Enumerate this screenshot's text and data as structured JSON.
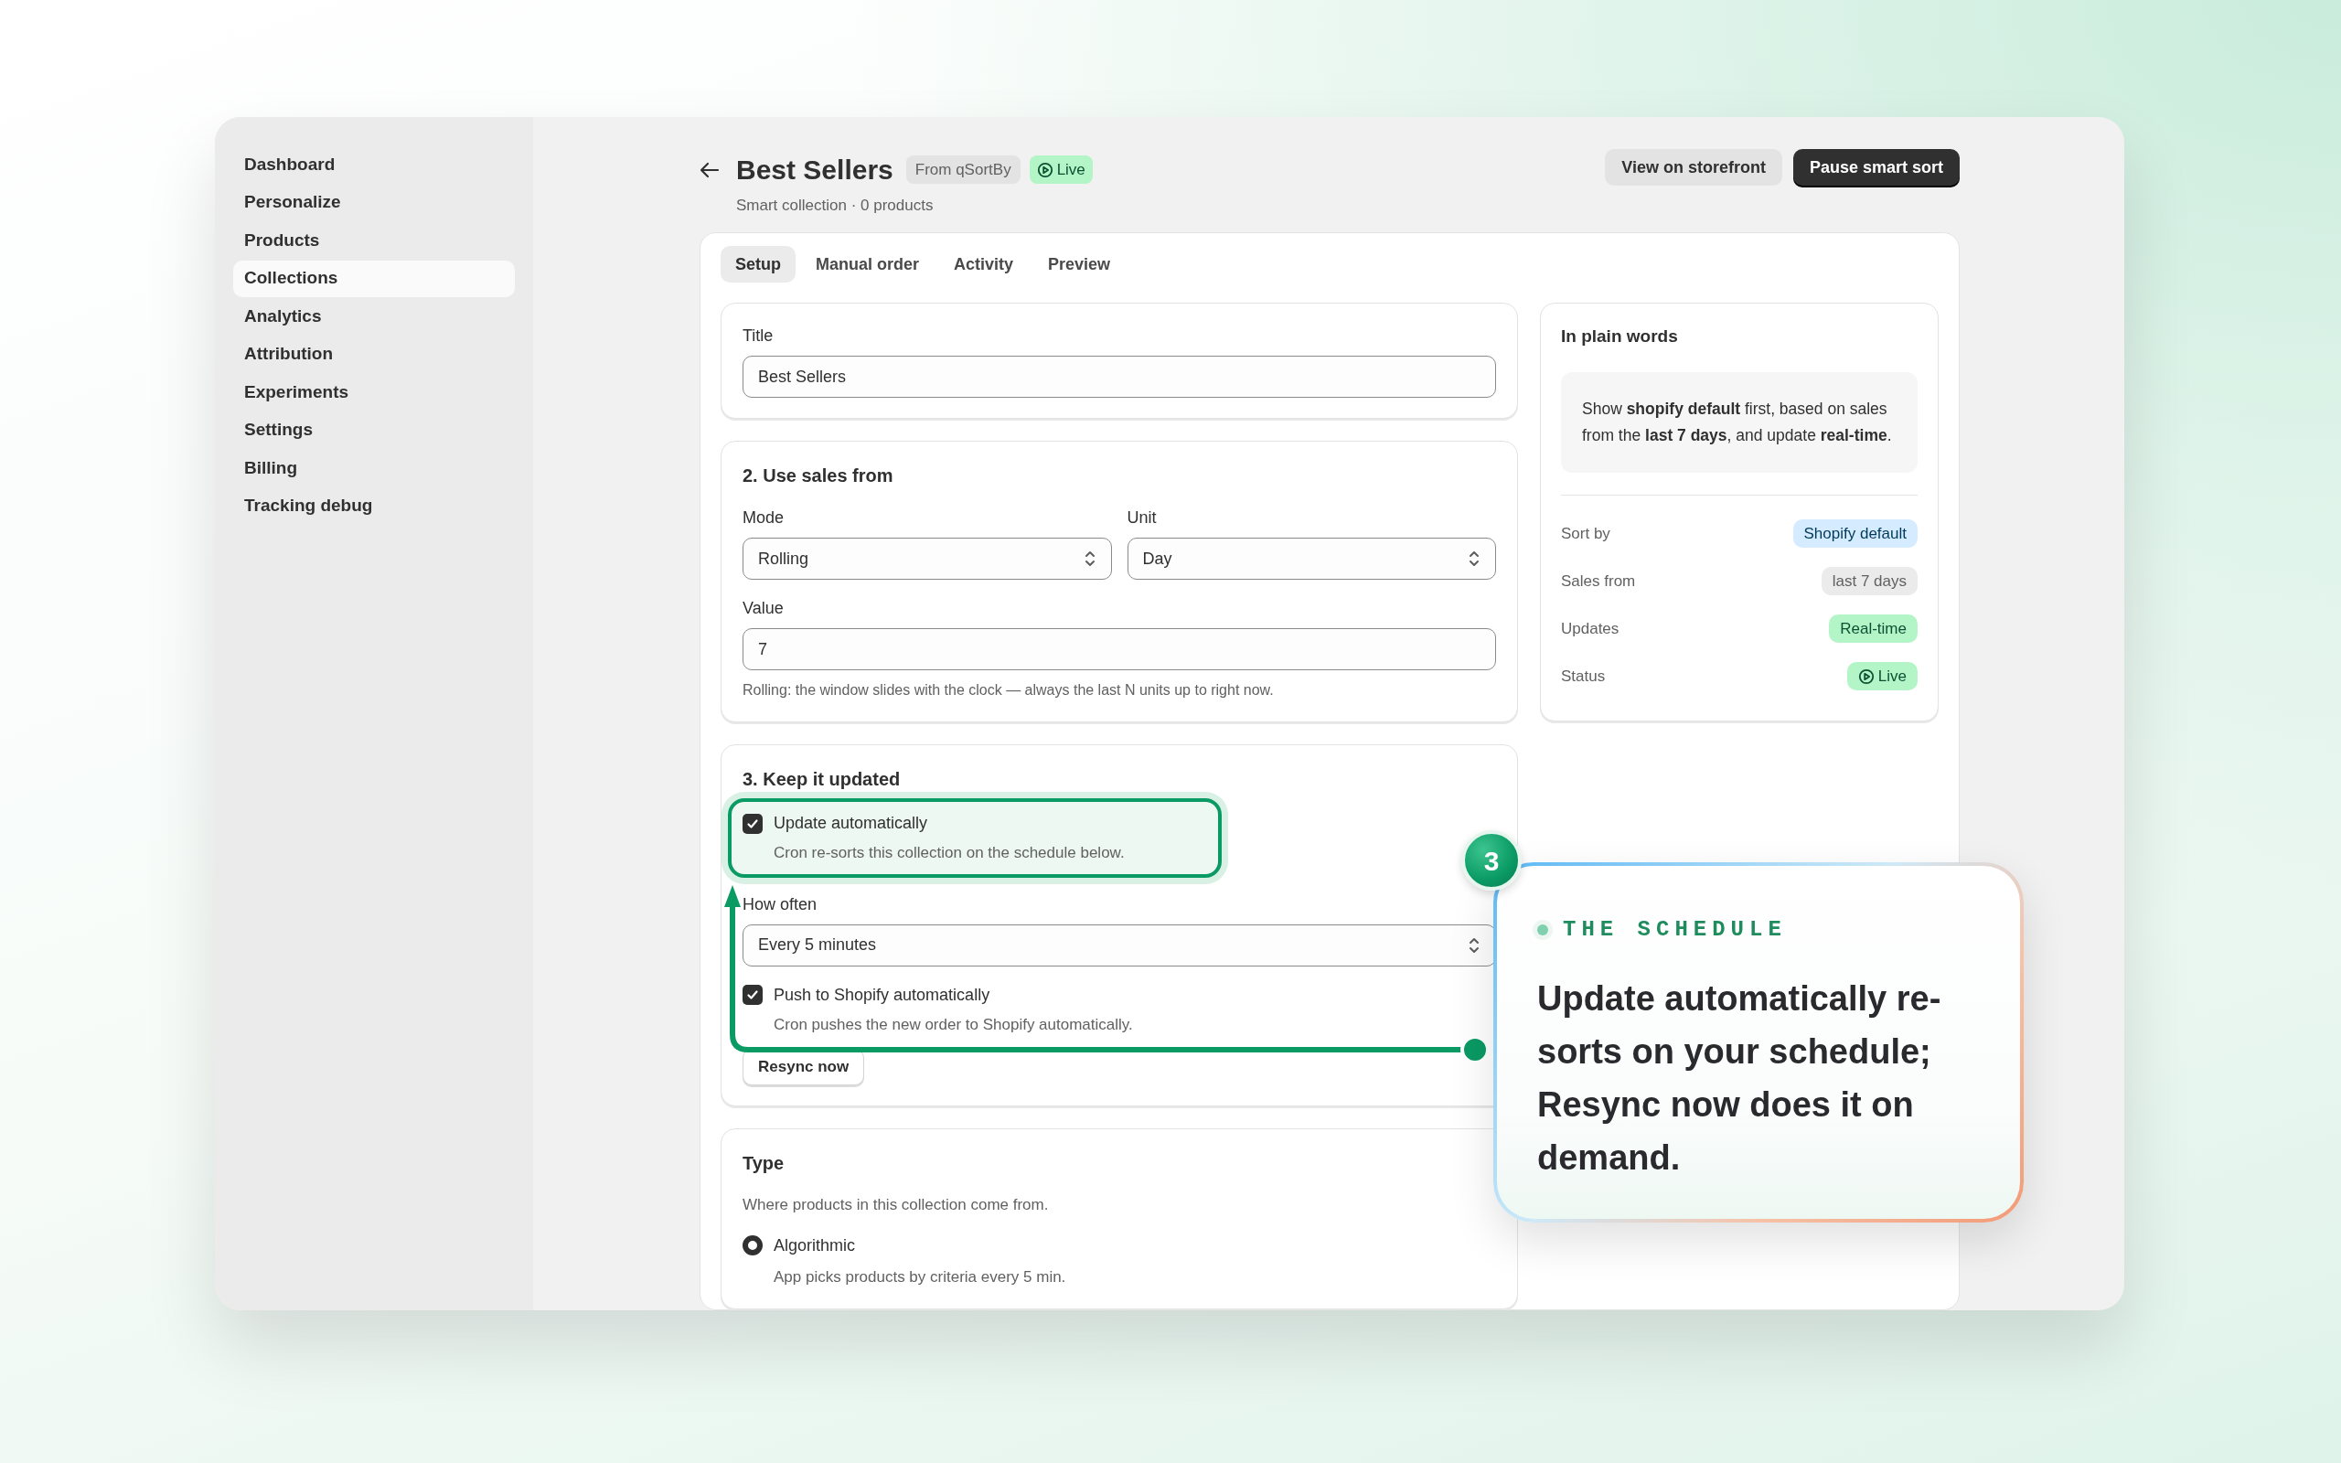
{
  "sidebar": {
    "items": [
      {
        "label": "Dashboard",
        "selected": false
      },
      {
        "label": "Personalize",
        "selected": false
      },
      {
        "label": "Products",
        "selected": false
      },
      {
        "label": "Collections",
        "selected": true
      },
      {
        "label": "Analytics",
        "selected": false
      },
      {
        "label": "Attribution",
        "selected": false
      },
      {
        "label": "Experiments",
        "selected": false
      },
      {
        "label": "Settings",
        "selected": false
      },
      {
        "label": "Billing",
        "selected": false
      },
      {
        "label": "Tracking debug",
        "selected": false
      }
    ]
  },
  "header": {
    "title": "Best Sellers",
    "source_badge": "From qSortBy",
    "status_badge": "Live",
    "subtitle": "Smart collection · 0 products",
    "actions": [
      {
        "label": "View on storefront",
        "kind": "secondary"
      },
      {
        "label": "Pause smart sort",
        "kind": "primary"
      }
    ]
  },
  "tabs": [
    {
      "label": "Setup",
      "selected": true
    },
    {
      "label": "Manual order",
      "selected": false
    },
    {
      "label": "Activity",
      "selected": false
    },
    {
      "label": "Preview",
      "selected": false
    }
  ],
  "title_card": {
    "label": "Title",
    "value": "Best Sellers"
  },
  "sales_card": {
    "heading": "2. Use sales from",
    "mode": {
      "label": "Mode",
      "value": "Rolling"
    },
    "unit": {
      "label": "Unit",
      "value": "Day"
    },
    "value": {
      "label": "Value",
      "value": "7"
    },
    "help": "Rolling: the window slides with the clock — always the last N units up to right now."
  },
  "update_card": {
    "heading": "3. Keep it updated",
    "items": [
      {
        "kind": "checkbox",
        "label": "Update automatically",
        "description": "Cron re-sorts this collection on the schedule below.",
        "checked": true,
        "highlighted": true
      },
      {
        "kind": "select",
        "label": "How often",
        "value": "Every 5 minutes"
      },
      {
        "kind": "checkbox",
        "label": "Push to Shopify automatically",
        "description": "Cron pushes the new order to Shopify automatically.",
        "checked": true,
        "highlighted": false
      },
      {
        "kind": "button",
        "label": "Resync now"
      }
    ]
  },
  "type_card": {
    "heading": "Type",
    "description": "Where products in this collection come from.",
    "options": [
      {
        "label": "Algorithmic",
        "description": "App picks products by criteria every 5 min.",
        "selected": true
      }
    ]
  },
  "summary": {
    "heading": "In plain words",
    "text": "Show **shopify default** first, based on sales from the **last 7 days**, and update **real-time**.",
    "rows": [
      {
        "label": "Sort by",
        "value": "Shopify default",
        "kind": "info"
      },
      {
        "label": "Sales from",
        "value": "last 7 days",
        "kind": "neutral"
      },
      {
        "label": "Updates",
        "value": "Real-time",
        "kind": "success"
      },
      {
        "label": "Status",
        "value": "Live",
        "kind": "live"
      }
    ]
  },
  "callout": {
    "step": "3",
    "eyebrow": "THE SCHEDULE",
    "text": "**Update automatically** re-sorts on your schedule; **Resync now** does it on demand."
  }
}
